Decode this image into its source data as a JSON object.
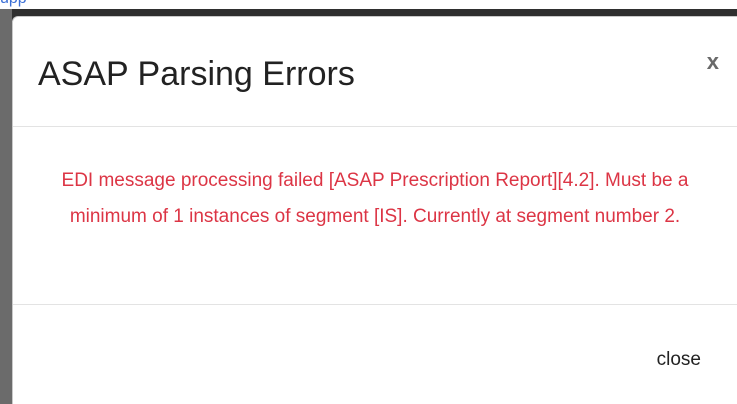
{
  "background": {
    "link_text": "upp",
    "link_color": "#3b6fd6"
  },
  "modal": {
    "title": "ASAP Parsing Errors",
    "close_x_label": "x",
    "error_message": "EDI message processing failed [ASAP Prescription Report][4.2]. Must be a minimum of 1 instances of segment [IS]. Currently at segment number 2.",
    "error_color": "#dc3545",
    "close_button_label": "close"
  }
}
